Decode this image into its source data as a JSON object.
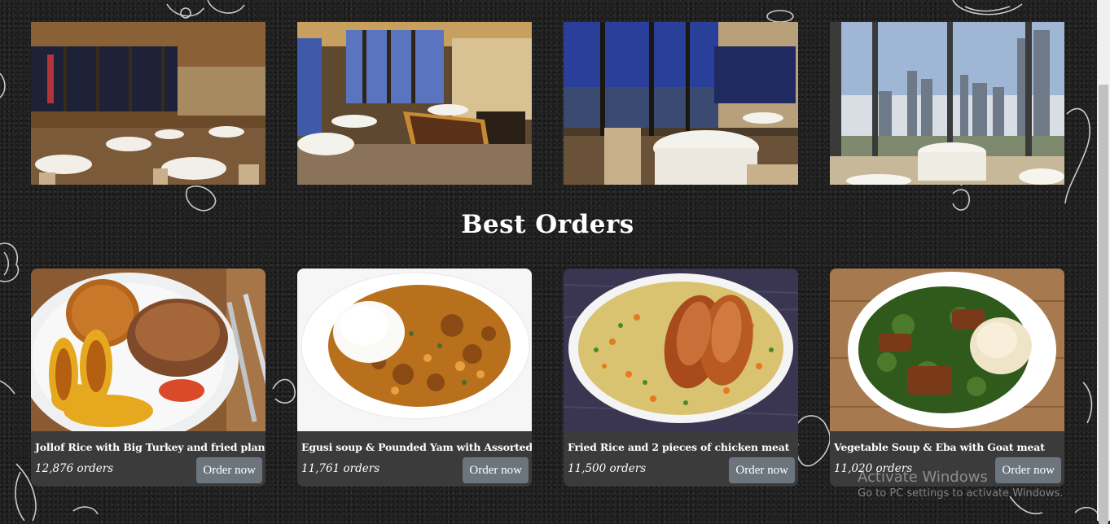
{
  "gallery": {
    "images": [
      {
        "label": "restaurant-interior-photo-1"
      },
      {
        "label": "restaurant-interior-photo-2"
      },
      {
        "label": "restaurant-interior-photo-3"
      },
      {
        "label": "restaurant-interior-photo-4"
      }
    ]
  },
  "best_orders": {
    "title": "Best Orders",
    "items": [
      {
        "name": "Jollof Rice with Big Turkey and fried plantains",
        "count": "12,876 orders",
        "button": "Order now"
      },
      {
        "name": "Egusi soup & Pounded Yam with Assorted",
        "count": "11,761 orders",
        "button": "Order now"
      },
      {
        "name": "Fried Rice and 2 pieces of chicken meat",
        "count": "11,500 orders",
        "button": "Order now"
      },
      {
        "name": "Vegetable Soup & Eba with Goat meat",
        "count": "11,020 orders",
        "button": "Order now"
      }
    ]
  },
  "watermark": {
    "title": "Activate Windows",
    "subtitle": "Go to PC settings to activate Windows."
  },
  "colors": {
    "background": "#1f1f1f",
    "card": "#3b3b3b",
    "button": "#6c757d",
    "text": "#ffffff"
  }
}
